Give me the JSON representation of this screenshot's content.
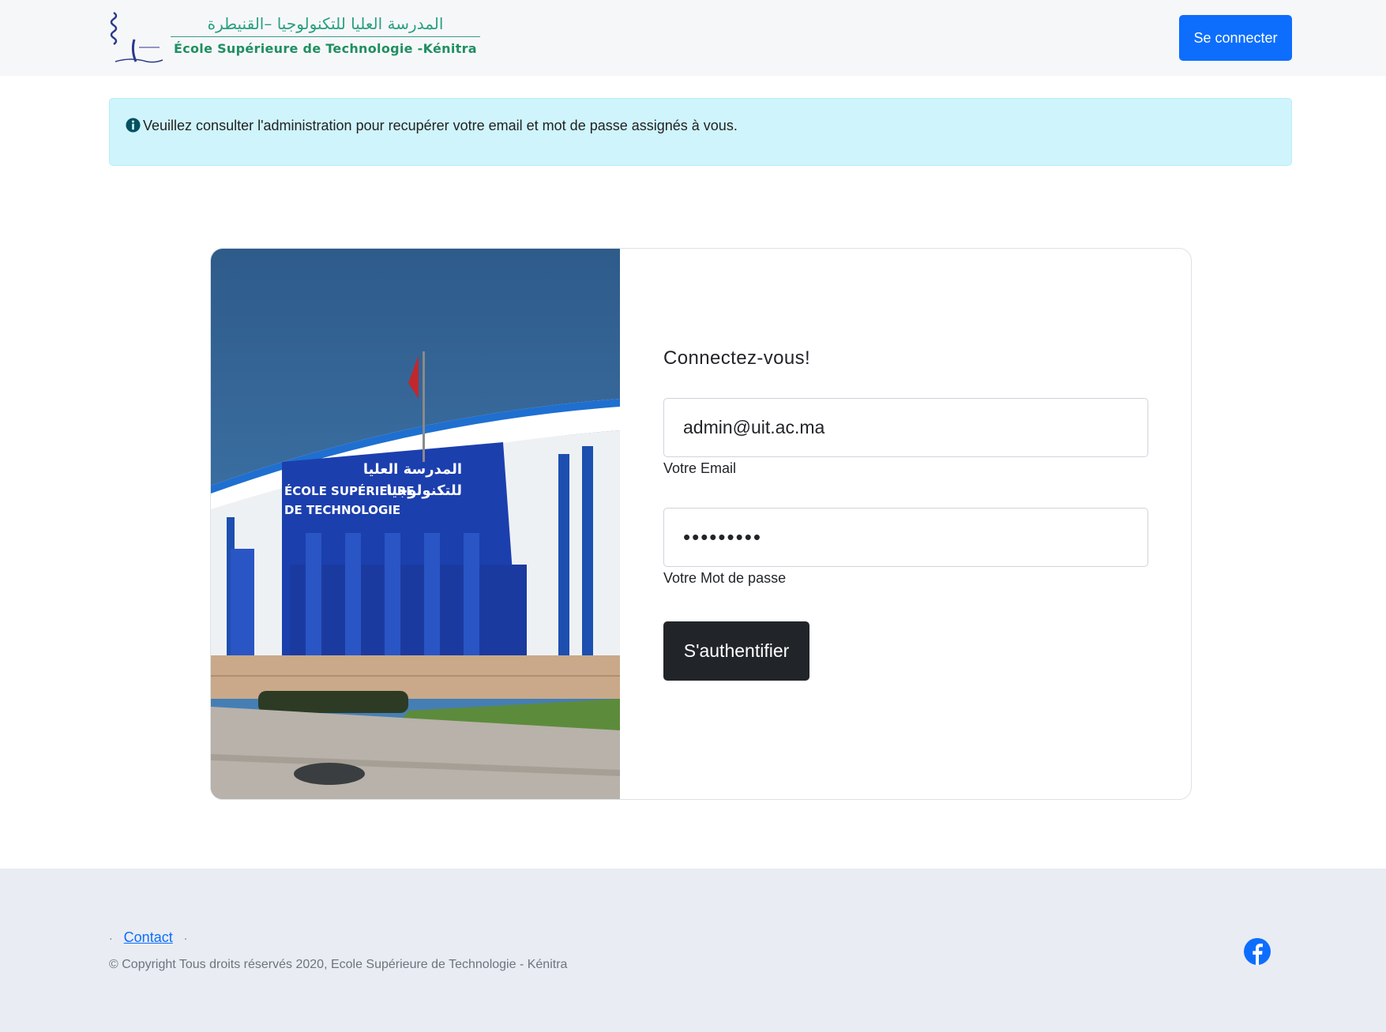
{
  "header": {
    "logo_ar": "المدرسة العليا للتكنولوجيا –القنيطرة",
    "logo_fr": "École Supérieure de Technologie -Kénitra",
    "login_button": "Se connecter"
  },
  "alert": {
    "icon": "info-icon",
    "text": "Veuillez consulter l'administration pour recupérer votre email et mot de passe assignés à vous."
  },
  "login": {
    "title": "Connectez-vous!",
    "email_value": "admin@uit.ac.ma",
    "email_label": "Votre Email",
    "password_value": "•••••••••",
    "password_label": "Votre Mot de passe",
    "submit_label": "S'authentifier"
  },
  "building": {
    "sign_fr_line1": "ÉCOLE SUPÉRIEURE",
    "sign_fr_line2": "DE TECHNOLOGIE",
    "sign_ar_line1": "المدرسة العليا",
    "sign_ar_line2": "للتكنولوجيا"
  },
  "footer": {
    "contact_link": "Contact",
    "copyright": "© Copyright Tous droits réservés 2020, Ecole Supérieure de Technologie - Kénitra",
    "social_icon": "facebook-icon"
  },
  "colors": {
    "primary": "#0d6efd",
    "dark": "#212529",
    "alert_bg": "#cff4fc",
    "footer_bg": "#e9ecf3",
    "header_bg": "#f6f7f9"
  }
}
